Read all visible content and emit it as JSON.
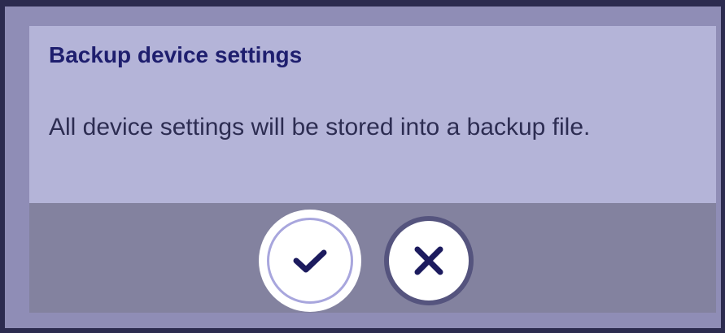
{
  "dialog": {
    "title": "Backup device settings",
    "message": "All device settings will be stored into a backup file."
  },
  "actions": {
    "confirm": {
      "icon": "checkmark-icon"
    },
    "cancel": {
      "icon": "close-icon"
    }
  },
  "colors": {
    "title": "#1e1e6e",
    "body_background": "#b4b4d8",
    "footer_background": "#83829f",
    "icon": "#1c1b5e"
  }
}
